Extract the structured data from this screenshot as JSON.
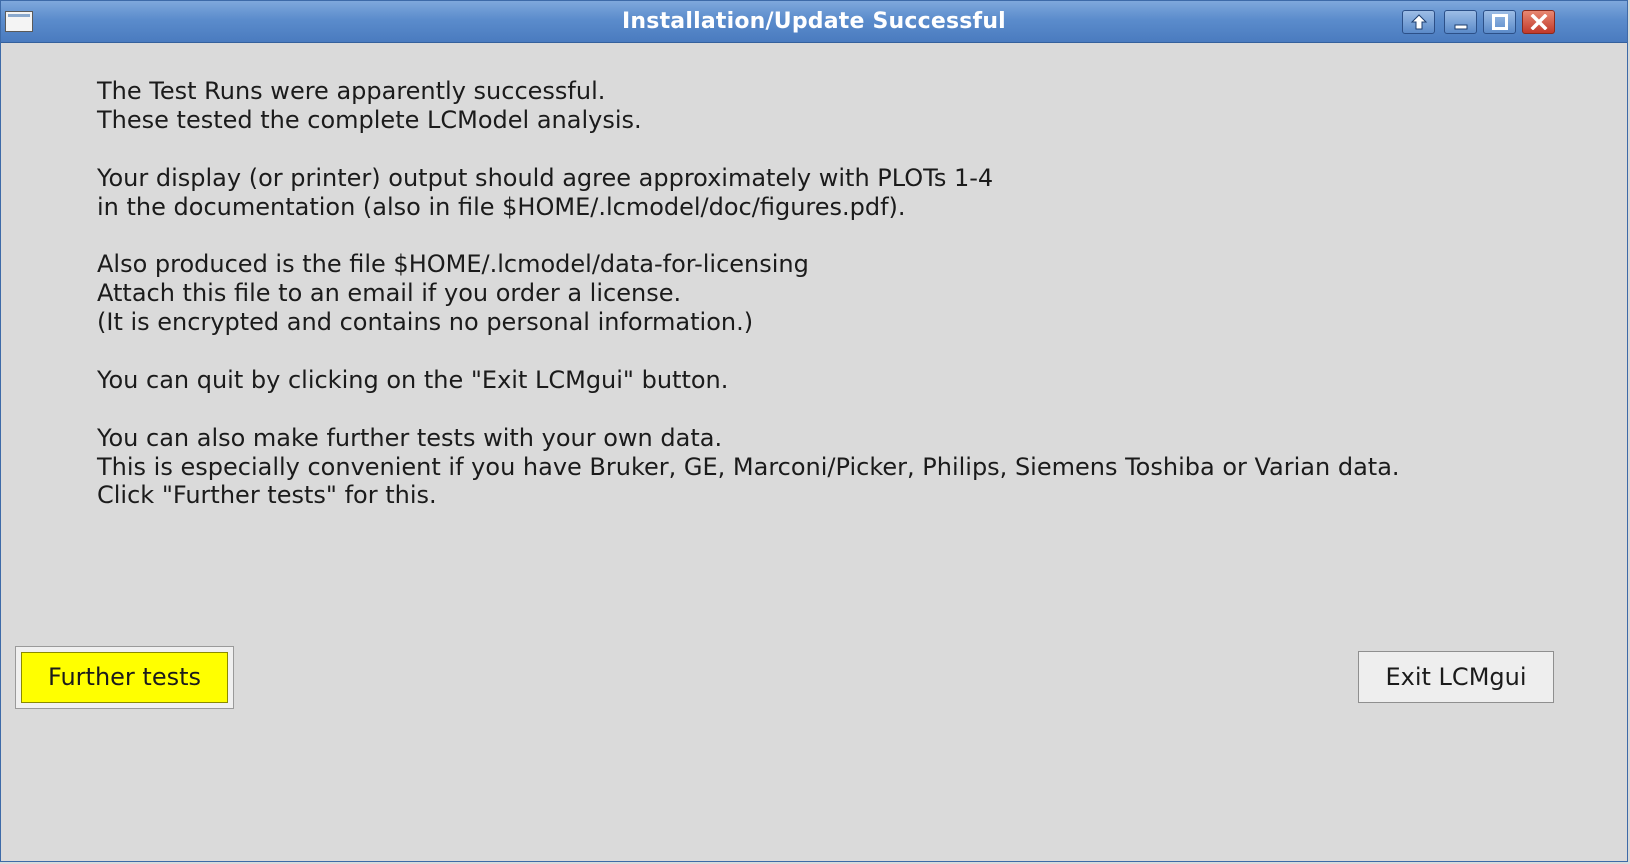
{
  "window": {
    "title": "Installation/Update Successful",
    "controls": [
      {
        "name": "shade-icon"
      },
      {
        "name": "minimize-icon"
      },
      {
        "name": "maximize-icon"
      },
      {
        "name": "close-icon"
      }
    ]
  },
  "message": {
    "lines": [
      "The Test Runs were apparently successful.",
      "These tested the complete LCModel analysis.",
      "",
      "Your display (or printer) output should agree approximately with PLOTs 1-4",
      "in the documentation (also in file $HOME/.lcmodel/doc/figures.pdf).",
      "",
      "Also produced is the file $HOME/.lcmodel/data-for-licensing",
      "Attach this file to an email if you order a license.",
      "(It is encrypted and contains no personal information.)",
      "",
      "You can quit by clicking on the \"Exit LCMgui\" button.",
      "",
      "You can also make further tests with your own data.",
      "This is especially convenient if you have Bruker, GE, Marconi/Picker, Philips, Siemens Toshiba or Varian data.",
      "Click \"Further tests\" for this."
    ]
  },
  "buttons": {
    "further_tests": "Further tests",
    "exit": "Exit LCMgui"
  },
  "colors": {
    "titlebar": "#5b8ccc",
    "background": "#dadada",
    "further_tests_bg": "#ffff00",
    "close_button": "#c0392b"
  }
}
